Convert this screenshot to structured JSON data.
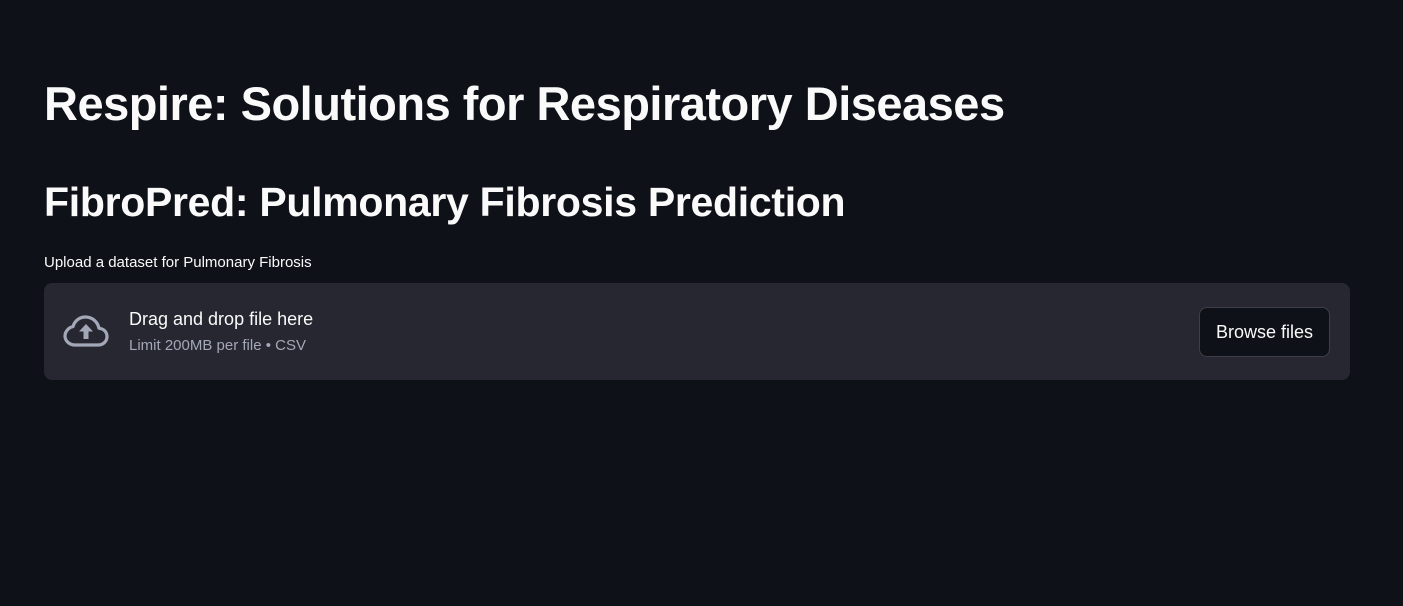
{
  "app": {
    "title": "Respire: Solutions for Respiratory Diseases"
  },
  "section": {
    "title": "FibroPred: Pulmonary Fibrosis Prediction"
  },
  "uploader": {
    "label": "Upload a dataset for Pulmonary Fibrosis",
    "drag_text": "Drag and drop file here",
    "limit_text": "Limit 200MB per file • CSV",
    "browse_label": "Browse files",
    "icon": "cloud-upload-icon"
  },
  "colors": {
    "background": "#0e1117",
    "dropzone": "#262730",
    "text": "#fafafa",
    "muted": "#a3a8b8"
  }
}
